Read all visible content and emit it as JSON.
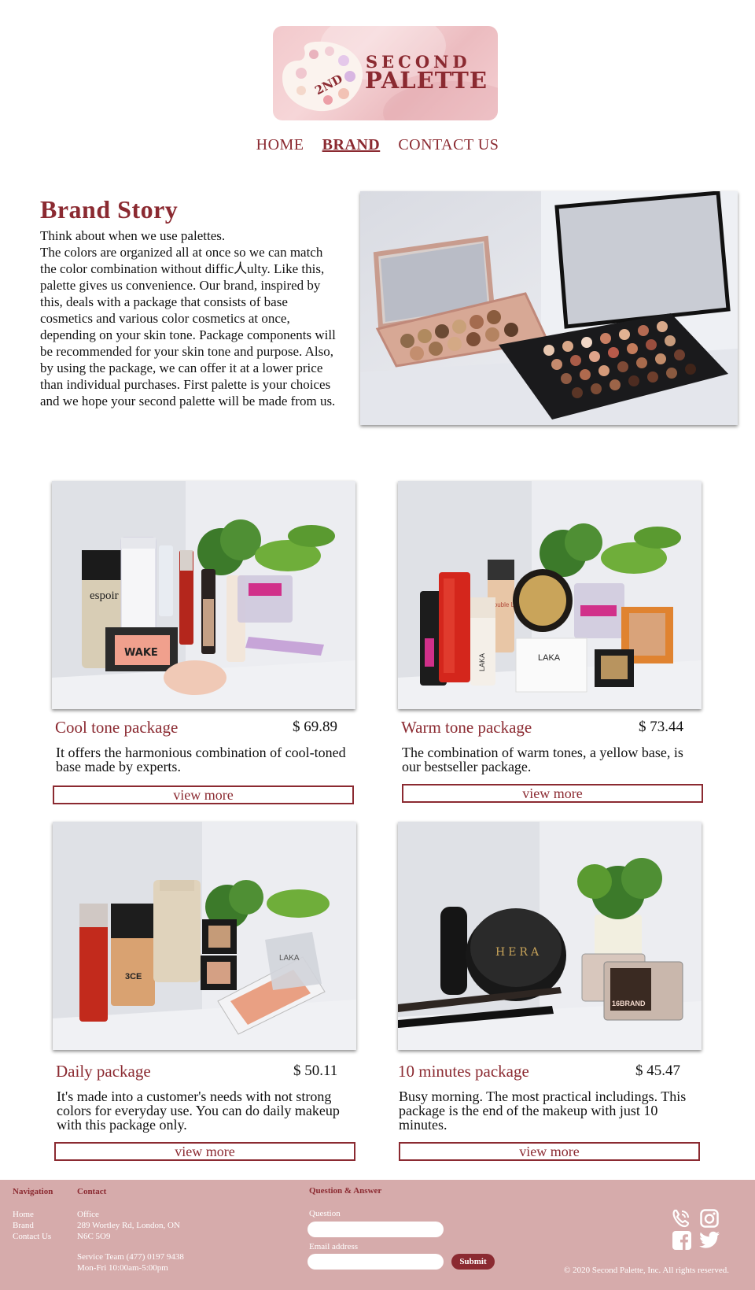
{
  "brand": {
    "logo_number": "2ND",
    "logo_word1": "SECOND",
    "logo_word2": "PALETTE"
  },
  "nav": [
    {
      "label": "HOME",
      "active": false
    },
    {
      "label": "BRAND",
      "active": true
    },
    {
      "label": "CONTACT US",
      "active": false
    }
  ],
  "story": {
    "title": "Brand Story",
    "line1": "Think about when we use palettes.",
    "body": "The colors are organized all at once so we can match the color combination without diffic人ulty. Like this, palette gives us convenience. Our brand, inspired by this, deals with a package that consists of base cosmetics and various color cosmetics at once, depending on your skin tone. Package components will be recommended for your skin tone and purpose. Also, by using the package, we can offer it at a lower price than individual purchases. First palette is your choices and we hope your second palette will be made from us."
  },
  "products": [
    {
      "title": "Cool tone package",
      "price": "$ 69.89",
      "desc": "It offers the harmonious combination of cool-toned base made by experts.",
      "button": "view more"
    },
    {
      "title": "Warm tone package",
      "price": "$ 73.44",
      "desc": "The combination of warm tones, a yellow base, is our bestseller package.",
      "button": "view more"
    },
    {
      "title": "Daily package",
      "price": "$ 50.11",
      "desc": "It's made into a customer's needs with not strong colors for everyday use. You can do daily makeup with this package only.",
      "button": "view more"
    },
    {
      "title": "10 minutes package",
      "price": "$ 45.47",
      "desc": "Busy morning. The most practical includings. This package is the end of the makeup with just 10 minutes.",
      "button": "view more"
    }
  ],
  "photo_labels": {
    "cool_espoir": "espoir",
    "cool_wake": "WAKE",
    "warm_laka1": "LAKA",
    "warm_laka2": "LAKA",
    "warm_double": "Double Lasting",
    "daily_laka": "LAKA",
    "daily_ce": "3CE",
    "ten_hera": "HERA",
    "ten_16": "16BRAND"
  },
  "footer": {
    "nav_heading": "Navigation",
    "nav_links": [
      "Home",
      "Brand",
      "Contact Us"
    ],
    "contact_heading": "Contact",
    "office_label": "Office",
    "address1": "289 Wortley Rd, London, ON",
    "address2": "N6C 5O9",
    "service": "Service Team (477) 0197 9438",
    "hours": "Mon-Fri 10:00am-5:00pm",
    "qa_heading": "Question & Answer",
    "question_label": "Question",
    "question_value": "",
    "email_label": "Email address",
    "email_value": "",
    "submit": "Submit",
    "copyright": "© 2020 Second Palette, Inc. All rights reserved."
  },
  "colors": {
    "accent": "#8b2a31",
    "footer_bg": "#d6abab",
    "logo_bg": "#f2c9cc"
  },
  "icons": [
    "phone-icon",
    "instagram-icon",
    "facebook-icon",
    "twitter-icon"
  ]
}
